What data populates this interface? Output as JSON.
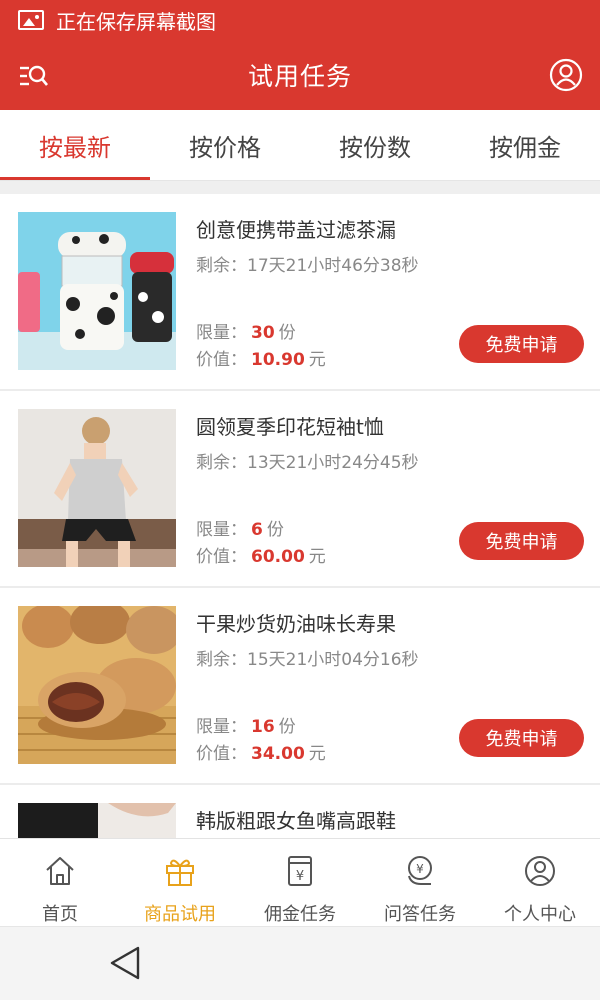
{
  "status_bar": {
    "text": "正在保存屏幕截图",
    "icon": "image-icon"
  },
  "header": {
    "title": "试用任务",
    "left_icon": "search-menu-icon",
    "right_icon": "user-icon"
  },
  "colors": {
    "brand": "#d9382f",
    "nav_active": "#e8a21b"
  },
  "tabs": [
    {
      "label": "按最新",
      "active": true
    },
    {
      "label": "按价格",
      "active": false
    },
    {
      "label": "按份数",
      "active": false
    },
    {
      "label": "按佣金",
      "active": false
    }
  ],
  "items": [
    {
      "name": "创意便携带盖过滤茶漏",
      "remaining": "剩余：17天21小时46分38秒",
      "quota_label": "限量：",
      "quota": "30",
      "quota_unit": "份",
      "value_label": "价值：",
      "value": "10.90",
      "value_unit": "元",
      "button": "免费申请"
    },
    {
      "name": "圆领夏季印花短袖t恤",
      "remaining": "剩余：13天21小时24分45秒",
      "quota_label": "限量：",
      "quota": "6",
      "quota_unit": "份",
      "value_label": "价值：",
      "value": "60.00",
      "value_unit": "元",
      "button": "免费申请"
    },
    {
      "name": "干果炒货奶油味长寿果",
      "remaining": "剩余：15天21小时04分16秒",
      "quota_label": "限量：",
      "quota": "16",
      "quota_unit": "份",
      "value_label": "价值：",
      "value": "34.00",
      "value_unit": "元",
      "button": "免费申请"
    },
    {
      "name": "韩版粗跟女鱼嘴高跟鞋"
    }
  ],
  "bottom_nav": [
    {
      "label": "首页",
      "icon": "home-icon",
      "active": false
    },
    {
      "label": "商品试用",
      "icon": "gift-icon",
      "active": true
    },
    {
      "label": "佣金任务",
      "icon": "yen-box-icon",
      "active": false
    },
    {
      "label": "问答任务",
      "icon": "yen-chat-icon",
      "active": false
    },
    {
      "label": "个人中心",
      "icon": "person-icon",
      "active": false
    }
  ]
}
